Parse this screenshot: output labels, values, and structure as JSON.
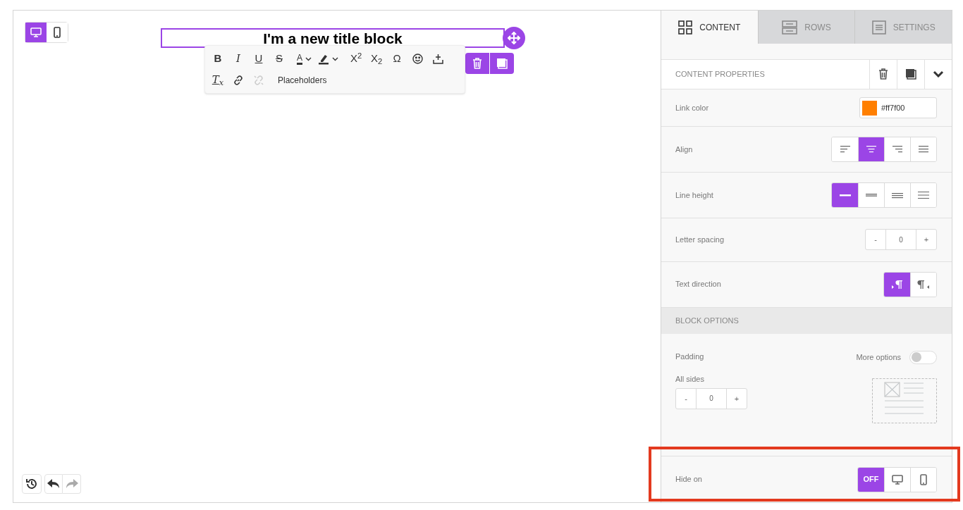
{
  "view_toggle": [
    {
      "kind": "desktop",
      "selected": true
    },
    {
      "kind": "mobile",
      "selected": false
    }
  ],
  "title_block": {
    "text": "I'm a new title block"
  },
  "text_toolbar": {
    "rows": [
      [
        {
          "kind": "bold",
          "label": "B"
        },
        {
          "kind": "italic",
          "label": "I"
        },
        {
          "kind": "underline",
          "label": "U"
        },
        {
          "kind": "strike",
          "label": "S"
        },
        {
          "kind": "fontcolor",
          "label": "A"
        },
        {
          "kind": "highlight"
        },
        {
          "kind": "superscript",
          "label": "X$^{2}$"
        },
        {
          "kind": "subscript",
          "label": "X$_{2}$"
        },
        {
          "kind": "symbol",
          "label": "Ω"
        },
        {
          "kind": "emoji"
        },
        {
          "kind": "insert"
        }
      ],
      [
        {
          "kind": "clearformat",
          "label": "T$_{x}$"
        },
        {
          "kind": "link",
          "disabled": false
        },
        {
          "kind": "unlink",
          "disabled": true
        },
        {
          "kind": "text",
          "label": "Placeholders"
        }
      ]
    ]
  },
  "tabs": [
    {
      "label": "CONTENT",
      "kind": "content",
      "selected": true
    },
    {
      "label": "ROWS",
      "kind": "rows",
      "selected": false
    },
    {
      "label": "SETTINGS",
      "kind": "settings",
      "selected": false
    }
  ],
  "content_properties": {
    "title": "CONTENT PROPERTIES"
  },
  "properties": [
    {
      "kind": "color",
      "label": "Link color",
      "value": "#ff7f00",
      "color": "#ff7f00"
    },
    {
      "kind": "align",
      "label": "Align",
      "options": [
        {
          "kind": "left",
          "selected": false
        },
        {
          "kind": "center",
          "selected": true
        },
        {
          "kind": "right",
          "selected": false
        },
        {
          "kind": "justify",
          "selected": false
        }
      ]
    },
    {
      "kind": "lineheight",
      "label": "Line height",
      "options": [
        {
          "kind": "single",
          "selected": true
        },
        {
          "kind": "medium",
          "selected": false
        },
        {
          "kind": "large",
          "selected": false
        },
        {
          "kind": "double",
          "selected": false
        }
      ]
    },
    {
      "kind": "stepper",
      "label": "Letter spacing",
      "minus": "-",
      "value": "0",
      "plus": "+"
    },
    {
      "kind": "direction",
      "label": "Text direction",
      "options": [
        {
          "kind": "ltr",
          "selected": true
        },
        {
          "kind": "rtl",
          "selected": false
        }
      ]
    }
  ],
  "block_options": {
    "title": "BLOCK OPTIONS",
    "padding_label": "Padding",
    "more_options_label": "More options",
    "more_options_on": false,
    "sides_label": "All sides",
    "minus": "-",
    "value": "0",
    "plus": "+"
  },
  "hide_on": {
    "label": "Hide on",
    "highlighted": true,
    "options": [
      {
        "kind": "off",
        "label": "OFF",
        "selected": true
      },
      {
        "kind": "desktop",
        "selected": false
      },
      {
        "kind": "mobile",
        "selected": false
      }
    ]
  },
  "history": {
    "undo_disabled": false,
    "redo_disabled": true
  }
}
